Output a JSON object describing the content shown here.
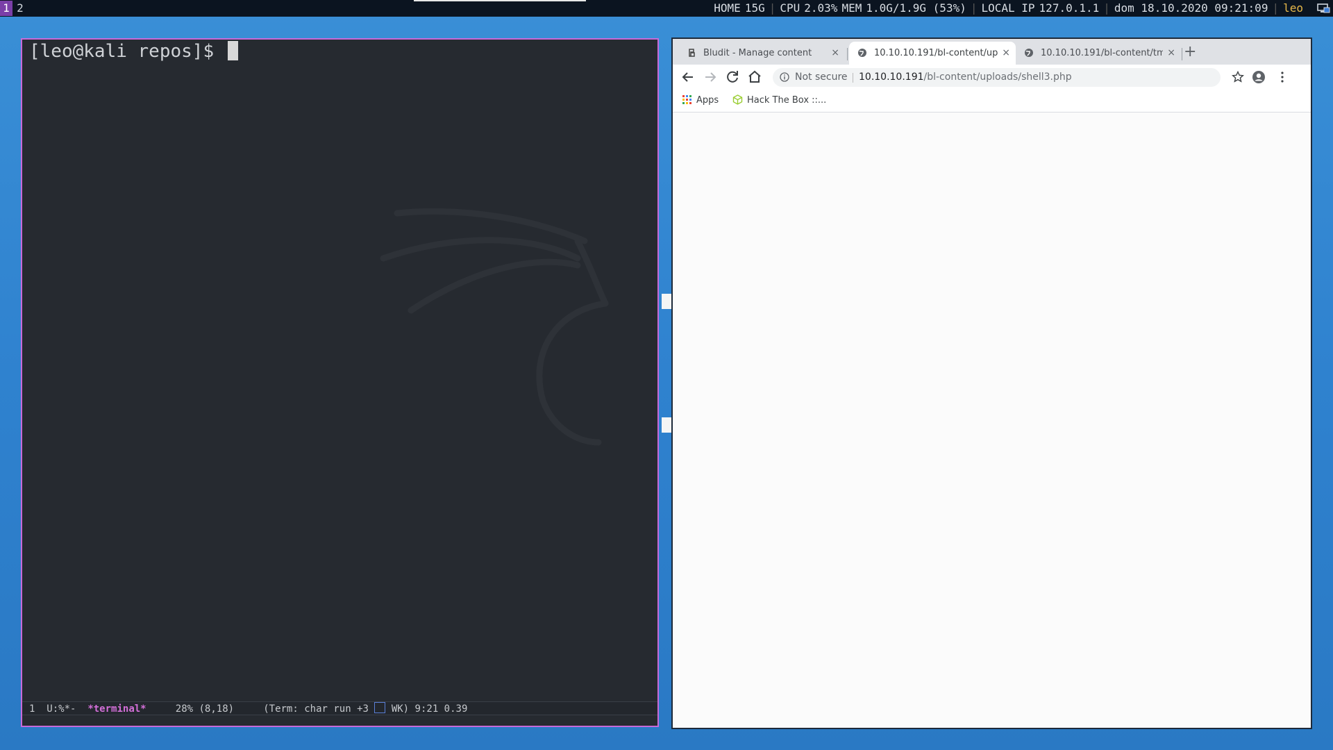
{
  "topbar": {
    "workspaces": [
      "1",
      "2"
    ],
    "stats": {
      "home_label": "HOME",
      "home_value": "15G",
      "cpu_label": "CPU",
      "cpu_value": "2.03%",
      "mem_label": "MEM",
      "mem_value": "1.0G/1.9G (53%)",
      "ip_label": "LOCAL IP",
      "ip_value": "127.0.1.1",
      "datetime": "dom 18.10.2020 09:21:09",
      "user": "leo"
    },
    "tray_icon": "network-icon"
  },
  "terminal": {
    "prompt": "[leo@kali repos]$",
    "modeline": {
      "window_num": "1",
      "state": "U:%*-",
      "buffer": "*terminal*",
      "position": "28% (8,18)",
      "mode_pre": "(Term: char run +3",
      "mode_post": "WK) 9:21 0.39"
    },
    "background_logo": "kali-dragon-icon"
  },
  "browser": {
    "tabs": [
      {
        "title": "Bludit - Manage content",
        "icon": "bludit-icon",
        "active": false
      },
      {
        "title": "10.10.10.191/bl-content/up",
        "icon": "globe-icon",
        "active": true
      },
      {
        "title": "10.10.10.191/bl-content/tm",
        "icon": "globe-icon",
        "active": false
      }
    ],
    "new_tab_label": "+",
    "close_label": "×",
    "address": {
      "security_label": "Not secure",
      "host": "10.10.10.191",
      "path": "/bl-content/uploads/shell3.php"
    },
    "bookmarks": [
      {
        "label": "Apps",
        "icon": "apps-grid-icon"
      },
      {
        "label": "Hack The Box ::...",
        "icon": "htb-cube-icon"
      }
    ],
    "accent": "#1a73e8"
  },
  "colors": {
    "desktop": "#2f82cf",
    "terminal_bg": "#262a30",
    "terminal_border": "#c86ad8",
    "topbar_bg": "#0b1420",
    "workspace_active": "#7a3fa8"
  }
}
